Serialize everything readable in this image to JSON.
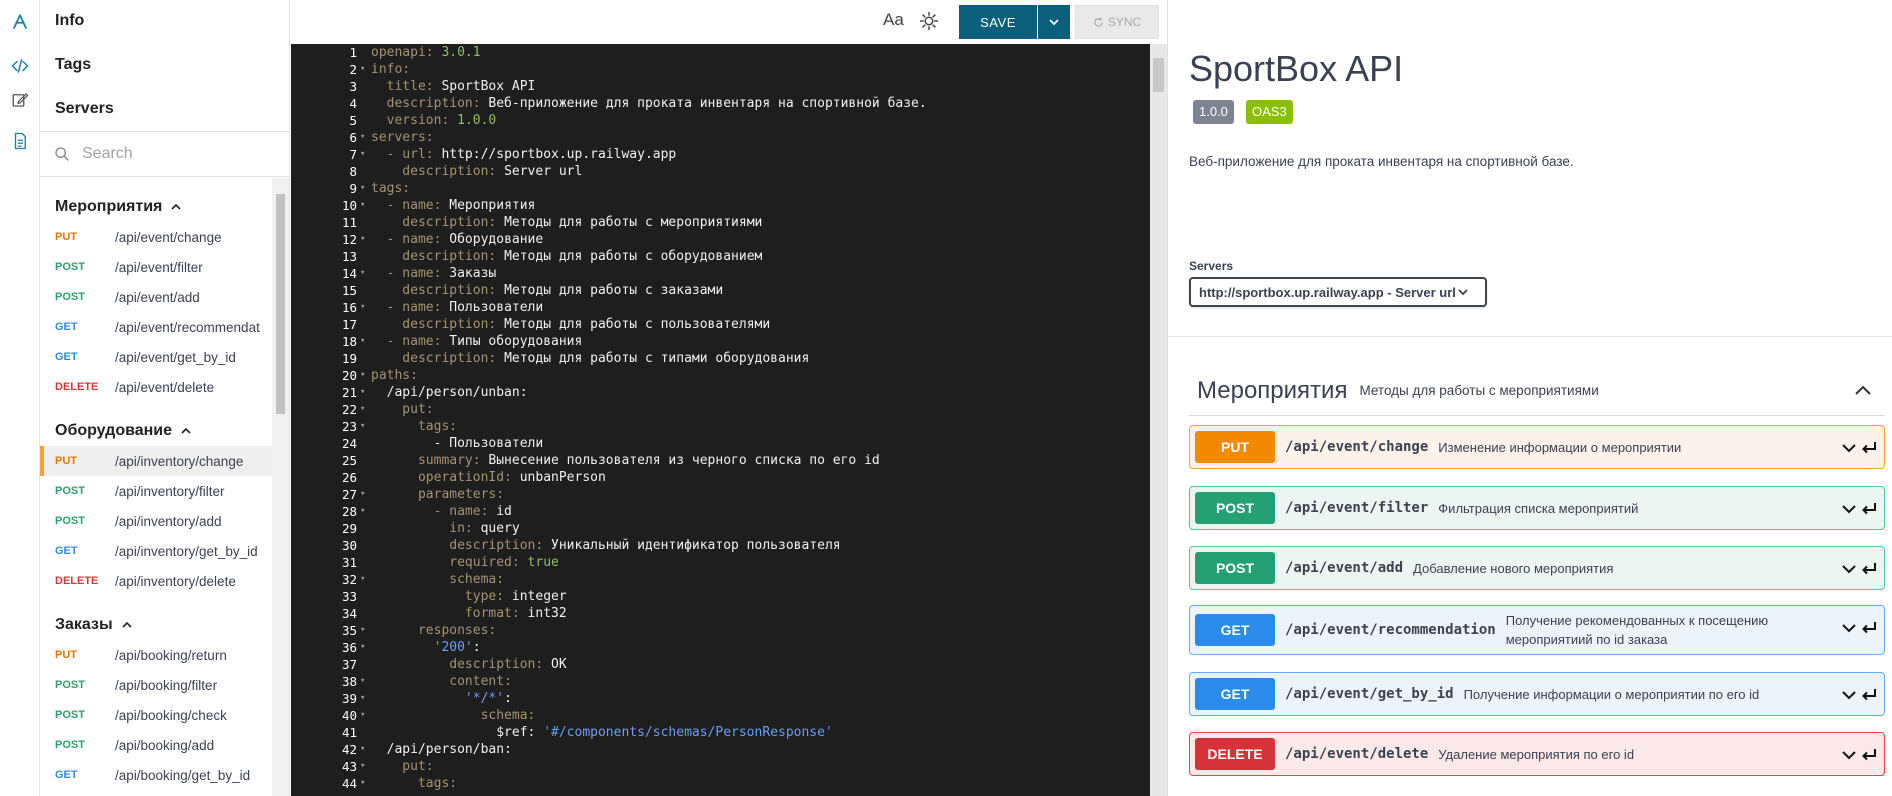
{
  "nav": {
    "top_links": [
      "Info",
      "Tags",
      "Servers"
    ],
    "search_placeholder": "Search",
    "groups": [
      {
        "name": "Мероприятия",
        "endpoints": [
          {
            "method": "PUT",
            "path": "/api/event/change"
          },
          {
            "method": "POST",
            "path": "/api/event/filter"
          },
          {
            "method": "POST",
            "path": "/api/event/add"
          },
          {
            "method": "GET",
            "path": "/api/event/recommendat"
          },
          {
            "method": "GET",
            "path": "/api/event/get_by_id"
          },
          {
            "method": "DELETE",
            "path": "/api/event/delete"
          }
        ]
      },
      {
        "name": "Оборудование",
        "endpoints": [
          {
            "method": "PUT",
            "path": "/api/inventory/change",
            "active": true
          },
          {
            "method": "POST",
            "path": "/api/inventory/filter"
          },
          {
            "method": "POST",
            "path": "/api/inventory/add"
          },
          {
            "method": "GET",
            "path": "/api/inventory/get_by_id"
          },
          {
            "method": "DELETE",
            "path": "/api/inventory/delete"
          }
        ]
      },
      {
        "name": "Заказы",
        "endpoints": [
          {
            "method": "PUT",
            "path": "/api/booking/return"
          },
          {
            "method": "POST",
            "path": "/api/booking/filter"
          },
          {
            "method": "POST",
            "path": "/api/booking/check"
          },
          {
            "method": "POST",
            "path": "/api/booking/add"
          },
          {
            "method": "GET",
            "path": "/api/booking/get_by_id"
          }
        ]
      }
    ]
  },
  "toolbar": {
    "font_label": "Aa",
    "save_label": "SAVE",
    "sync_label": "SYNC",
    "accent_color": "#0b5f7a"
  },
  "editor": {
    "lines": [
      {
        "n": 1,
        "fold": false,
        "tokens": [
          [
            "k",
            "openapi: "
          ],
          [
            "n",
            "3.0.1"
          ]
        ]
      },
      {
        "n": 2,
        "fold": true,
        "tokens": [
          [
            "k",
            "info:"
          ]
        ]
      },
      {
        "n": 3,
        "fold": false,
        "tokens": [
          [
            "k",
            "  title: "
          ],
          [
            "v",
            "SportBox API"
          ]
        ]
      },
      {
        "n": 4,
        "fold": false,
        "tokens": [
          [
            "k",
            "  description: "
          ],
          [
            "v",
            "Веб-приложение для проката инвентаря на спортивной базе."
          ]
        ]
      },
      {
        "n": 5,
        "fold": false,
        "tokens": [
          [
            "k",
            "  version: "
          ],
          [
            "n",
            "1.0.0"
          ]
        ]
      },
      {
        "n": 6,
        "fold": true,
        "tokens": [
          [
            "k",
            "servers:"
          ]
        ]
      },
      {
        "n": 7,
        "fold": true,
        "tokens": [
          [
            "k",
            "  - url: "
          ],
          [
            "v",
            "http://sportbox.up.railway.app"
          ]
        ]
      },
      {
        "n": 8,
        "fold": false,
        "tokens": [
          [
            "k",
            "    description: "
          ],
          [
            "v",
            "Server url"
          ]
        ]
      },
      {
        "n": 9,
        "fold": true,
        "tokens": [
          [
            "k",
            "tags:"
          ]
        ]
      },
      {
        "n": 10,
        "fold": true,
        "tokens": [
          [
            "k",
            "  - name: "
          ],
          [
            "v",
            "Мероприятия"
          ]
        ]
      },
      {
        "n": 11,
        "fold": false,
        "tokens": [
          [
            "k",
            "    description: "
          ],
          [
            "v",
            "Методы для работы с мероприятиями"
          ]
        ]
      },
      {
        "n": 12,
        "fold": true,
        "tokens": [
          [
            "k",
            "  - name: "
          ],
          [
            "v",
            "Оборудование"
          ]
        ]
      },
      {
        "n": 13,
        "fold": false,
        "tokens": [
          [
            "k",
            "    description: "
          ],
          [
            "v",
            "Методы для работы с оборудованием"
          ]
        ]
      },
      {
        "n": 14,
        "fold": true,
        "tokens": [
          [
            "k",
            "  - name: "
          ],
          [
            "v",
            "Заказы"
          ]
        ]
      },
      {
        "n": 15,
        "fold": false,
        "tokens": [
          [
            "k",
            "    description: "
          ],
          [
            "v",
            "Методы для работы с заказами"
          ]
        ]
      },
      {
        "n": 16,
        "fold": true,
        "tokens": [
          [
            "k",
            "  - name: "
          ],
          [
            "v",
            "Пользователи"
          ]
        ]
      },
      {
        "n": 17,
        "fold": false,
        "tokens": [
          [
            "k",
            "    description: "
          ],
          [
            "v",
            "Методы для работы с пользователями"
          ]
        ]
      },
      {
        "n": 18,
        "fold": true,
        "tokens": [
          [
            "k",
            "  - name: "
          ],
          [
            "v",
            "Типы оборудования"
          ]
        ]
      },
      {
        "n": 19,
        "fold": false,
        "tokens": [
          [
            "k",
            "    description: "
          ],
          [
            "v",
            "Методы для работы с типами оборудования"
          ]
        ]
      },
      {
        "n": 20,
        "fold": true,
        "tokens": [
          [
            "k",
            "paths:"
          ]
        ]
      },
      {
        "n": 21,
        "fold": true,
        "tokens": [
          [
            "v",
            "  /api/person/unban:"
          ]
        ]
      },
      {
        "n": 22,
        "fold": true,
        "tokens": [
          [
            "k",
            "    put:"
          ]
        ]
      },
      {
        "n": 23,
        "fold": true,
        "tokens": [
          [
            "k",
            "      tags:"
          ]
        ]
      },
      {
        "n": 24,
        "fold": false,
        "tokens": [
          [
            "v",
            "        - Пользователи"
          ]
        ]
      },
      {
        "n": 25,
        "fold": false,
        "tokens": [
          [
            "k",
            "      summary: "
          ],
          [
            "v",
            "Вынесение пользователя из черного списка по его id"
          ]
        ]
      },
      {
        "n": 26,
        "fold": false,
        "tokens": [
          [
            "k",
            "      operationId: "
          ],
          [
            "v",
            "unbanPerson"
          ]
        ]
      },
      {
        "n": 27,
        "fold": true,
        "tokens": [
          [
            "k",
            "      parameters:"
          ]
        ]
      },
      {
        "n": 28,
        "fold": true,
        "tokens": [
          [
            "k",
            "        - name: "
          ],
          [
            "v",
            "id"
          ]
        ]
      },
      {
        "n": 29,
        "fold": false,
        "tokens": [
          [
            "k",
            "          in: "
          ],
          [
            "v",
            "query"
          ]
        ]
      },
      {
        "n": 30,
        "fold": false,
        "tokens": [
          [
            "k",
            "          description: "
          ],
          [
            "v",
            "Уникальный идентификатор пользователя"
          ]
        ]
      },
      {
        "n": 31,
        "fold": false,
        "tokens": [
          [
            "k",
            "          required: "
          ],
          [
            "n",
            "true"
          ]
        ]
      },
      {
        "n": 32,
        "fold": true,
        "tokens": [
          [
            "k",
            "          schema:"
          ]
        ]
      },
      {
        "n": 33,
        "fold": false,
        "tokens": [
          [
            "k",
            "            type: "
          ],
          [
            "v",
            "integer"
          ]
        ]
      },
      {
        "n": 34,
        "fold": false,
        "tokens": [
          [
            "k",
            "            format: "
          ],
          [
            "v",
            "int32"
          ]
        ]
      },
      {
        "n": 35,
        "fold": true,
        "tokens": [
          [
            "k",
            "      responses:"
          ]
        ]
      },
      {
        "n": 36,
        "fold": true,
        "tokens": [
          [
            "s",
            "        '200'"
          ],
          [
            "v",
            ":"
          ]
        ]
      },
      {
        "n": 37,
        "fold": false,
        "tokens": [
          [
            "k",
            "          description: "
          ],
          [
            "v",
            "OK"
          ]
        ]
      },
      {
        "n": 38,
        "fold": true,
        "tokens": [
          [
            "k",
            "          content:"
          ]
        ]
      },
      {
        "n": 39,
        "fold": true,
        "tokens": [
          [
            "s",
            "            '*/*'"
          ],
          [
            "v",
            ":"
          ]
        ]
      },
      {
        "n": 40,
        "fold": true,
        "tokens": [
          [
            "k",
            "              schema:"
          ]
        ]
      },
      {
        "n": 41,
        "fold": false,
        "tokens": [
          [
            "v",
            "                $ref: "
          ],
          [
            "s",
            "'#/components/schemas/PersonResponse'"
          ]
        ]
      },
      {
        "n": 42,
        "fold": true,
        "tokens": [
          [
            "v",
            "  /api/person/ban:"
          ]
        ]
      },
      {
        "n": 43,
        "fold": true,
        "tokens": [
          [
            "k",
            "    put:"
          ]
        ]
      },
      {
        "n": 44,
        "fold": true,
        "tokens": [
          [
            "k",
            "      tags:"
          ]
        ]
      }
    ]
  },
  "docs": {
    "title": "SportBox API",
    "version_badge": "1.0.0",
    "oas_badge": "OAS3",
    "description": "Веб-приложение для проката инвентаря на спортивной базе.",
    "servers_label": "Servers",
    "server_value": "http://sportbox.up.railway.app - Server url",
    "tag": {
      "name": "Мероприятия",
      "description": "Методы для работы с мероприятиями"
    },
    "operations": [
      {
        "method": "PUT",
        "path": "/api/event/change",
        "summary": "Изменение информации о мероприятии"
      },
      {
        "method": "POST",
        "path": "/api/event/filter",
        "summary": "Фильтрация списка мероприятий"
      },
      {
        "method": "POST",
        "path": "/api/event/add",
        "summary": "Добавление нового мероприятия"
      },
      {
        "method": "GET",
        "path": "/api/event/recommendation",
        "summary": "Получение рекомендованных к посещению мероприятиий по id заказа"
      },
      {
        "method": "GET",
        "path": "/api/event/get_by_id",
        "summary": "Получение информации о мероприятии по его id"
      },
      {
        "method": "DELETE",
        "path": "/api/event/delete",
        "summary": "Удаление мероприятия по его id"
      }
    ],
    "method_colors": {
      "PUT": "#fca130",
      "POST": "#49cc90",
      "GET": "#61affe",
      "DELETE": "#f93e3e"
    }
  }
}
